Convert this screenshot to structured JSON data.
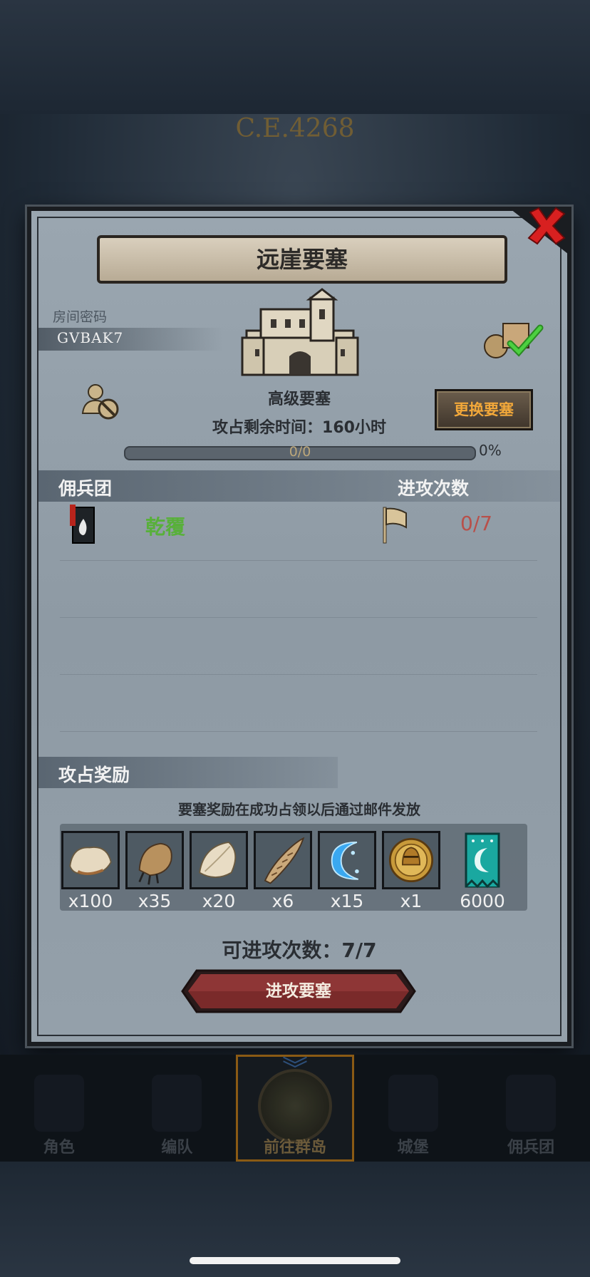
{
  "background": {
    "era_label": "C.E.4268"
  },
  "modal": {
    "title": "远崖要塞",
    "room_password_label": "房间密码",
    "room_code": "GVBAK7",
    "fortress_grade": "高级要塞",
    "change_fortress_label": "更换要塞",
    "time_left_label": "攻占剩余时间：",
    "time_left_value": "160小时",
    "progress": {
      "text": "0/0",
      "percent_label": "0%",
      "fraction": 0
    },
    "mercenary_header": "佣兵团",
    "attack_count_header": "进攻次数",
    "mercenaries": [
      {
        "name": "乾覆",
        "attacks": "0/7"
      }
    ],
    "rewards_header": "攻占奖励",
    "rewards_note": "要塞奖励在成功占领以后通过邮件发放",
    "rewards": [
      {
        "icon": "fur-pelt-icon",
        "qty": "x100"
      },
      {
        "icon": "beast-claw-icon",
        "qty": "x35"
      },
      {
        "icon": "feather-pelt-icon",
        "qty": "x20"
      },
      {
        "icon": "horn-icon",
        "qty": "x6"
      },
      {
        "icon": "blue-crescent-icon",
        "qty": "x15"
      },
      {
        "icon": "knight-coin-icon",
        "qty": "x1"
      },
      {
        "icon": "guild-banner-icon",
        "qty": "6000"
      }
    ],
    "attacks_available_label": "可进攻次数：",
    "attacks_available_value": "7/7",
    "attack_button_label": "进攻要塞"
  },
  "nav": {
    "items": [
      {
        "label": "角色",
        "active": false
      },
      {
        "label": "编队",
        "active": false
      },
      {
        "label": "前往群岛",
        "active": true
      },
      {
        "label": "城堡",
        "active": false
      },
      {
        "label": "佣兵团",
        "active": false
      }
    ]
  },
  "colors": {
    "accent_orange": "#f2a83a",
    "merc_green": "#58b03a",
    "count_red": "#b8504a",
    "close_red": "#d82020"
  }
}
